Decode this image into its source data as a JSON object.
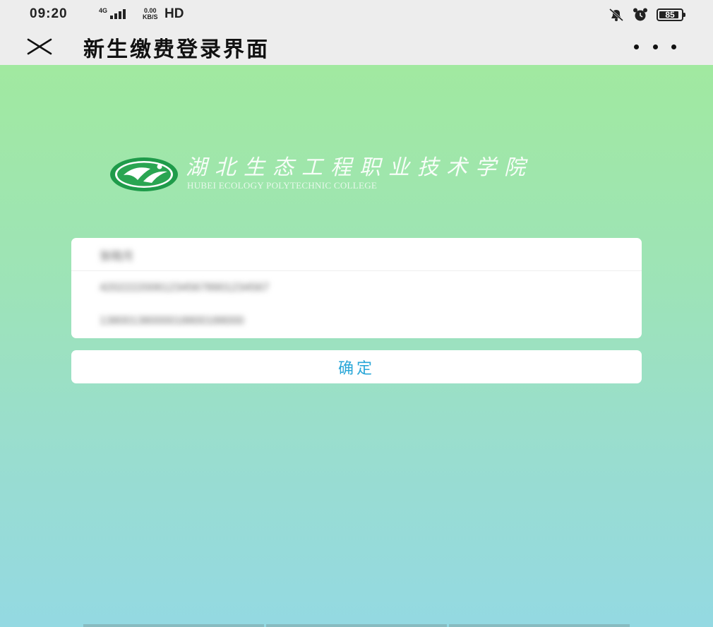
{
  "status_bar": {
    "time": "09:20",
    "network_type": "4G",
    "speed_value": "0.00",
    "speed_unit": "KB/S",
    "hd_label": "HD",
    "battery_level": "85",
    "icons": [
      "signal-icon",
      "mute-icon",
      "alarm-icon",
      "battery-icon"
    ]
  },
  "title_bar": {
    "title": "新生缴费登录界面",
    "close_icon": "close-icon",
    "more_icon": "more-icon"
  },
  "logo": {
    "name_zh": "湖北生态工程职业技术学院",
    "name_en": "HUBEI ECOLOGY POLYTECHNIC COLLEGE"
  },
  "form": {
    "name_value": "张晓月",
    "id_value": "420222200612345678901234567",
    "phone_value": "13800138000018800188000"
  },
  "confirm_button": {
    "label": "确定"
  },
  "colors": {
    "accent": "#2aa7d8",
    "gradient_top": "#a1e9a0",
    "gradient_bottom": "#94d9e2",
    "title_bar_bg": "#ededed"
  }
}
